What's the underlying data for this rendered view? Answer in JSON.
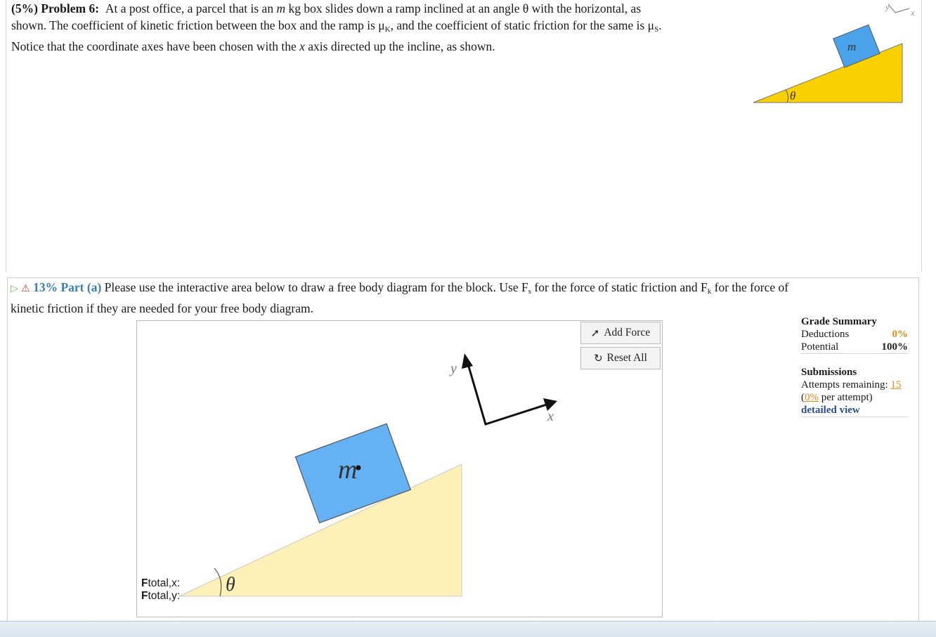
{
  "problem": {
    "weight": "(5%)",
    "label": "Problem 6:",
    "text_1": "At a post office, a parcel that is an",
    "m": "m",
    "text_2": "kg box slides down a ramp inclined at an angle θ with the horizontal, as",
    "text_3": "shown. The coefficient of kinetic friction between the box and the ramp is μ",
    "sub_k": "K",
    "text_4": ", and the coefficient of static friction for the same is μ",
    "sub_s": "S",
    "text_5": ".",
    "text_6": "Notice that the coordinate axes have been chosen with the",
    "x": "x",
    "text_7": "axis directed up the incline, as shown."
  },
  "figure": {
    "mass_label": "m",
    "angle_label": "θ",
    "axis_y": "y",
    "axis_x": "x",
    "ramp_color": "#f9d000",
    "box_color": "#4aa3ea"
  },
  "part_a": {
    "pct": "13% Part (a)",
    "text_1": "Please use the interactive area below to draw a free body diagram for the block. Use F",
    "sub_s": "s",
    "text_2": "for the force of static friction and F",
    "sub_k": "k",
    "text_3": "for the force of",
    "text_4": "kinetic friction if they are needed for your free body diagram."
  },
  "canvas": {
    "mass_label": "m",
    "angle_label": "θ",
    "axis_y": "y",
    "axis_x": "x",
    "ramp_color": "#fdf1b8",
    "box_color": "#64b1f3"
  },
  "tools": {
    "add_force": "Add Force",
    "reset_all": "Reset All"
  },
  "ftotal": {
    "F": "F",
    "x_label": "total,x",
    "y_label": "total,y",
    "colon": ":"
  },
  "grade_summary": {
    "title": "Grade Summary",
    "deductions_label": "Deductions",
    "deductions_value": "0%",
    "potential_label": "Potential",
    "potential_value": "100%"
  },
  "submissions": {
    "title": "Submissions",
    "attempts_label": "Attempts remaining:",
    "attempts_value": "15",
    "per_attempt_open": "(",
    "per_attempt_value": "0%",
    "per_attempt_label": "per attempt)",
    "detailed_view": "detailed view"
  }
}
